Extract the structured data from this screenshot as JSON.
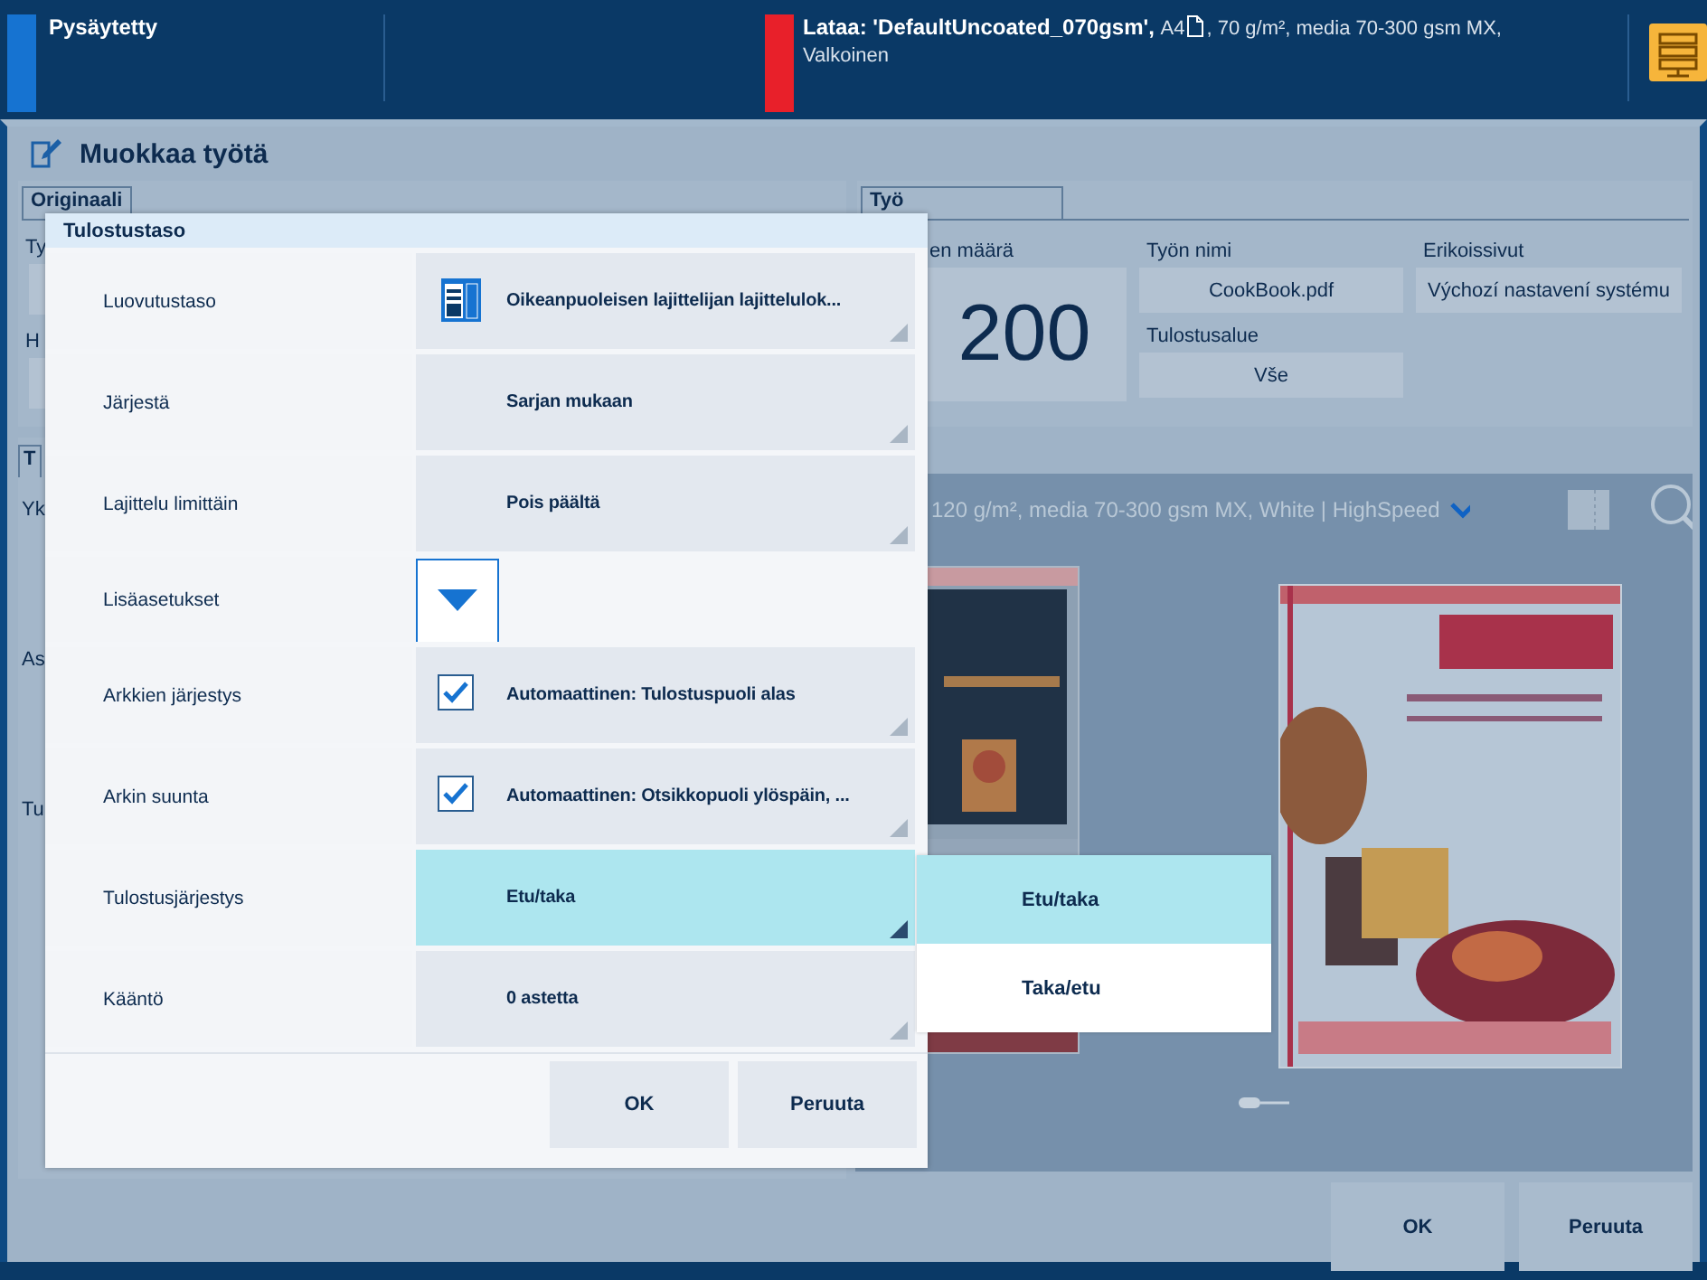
{
  "status_bar": {
    "state": "Pysäytetty",
    "load_label": "Lataa: 'DefaultUncoated_070gsm',",
    "load_size": "A4",
    "load_media": ", 70 g/m², media 70-300 gsm MX,",
    "load_color": "Valkoinen"
  },
  "window": {
    "title": "Muokkaa työtä"
  },
  "original_group": {
    "tab": "Originaali",
    "labels": [
      "Ty",
      "H"
    ]
  },
  "job_group": {
    "tab": "Työ",
    "count_label": "en määrä",
    "count": "200",
    "fields": [
      {
        "label": "Työn nimi",
        "value": "CookBook.pdf"
      },
      {
        "label": "Erikoissivut",
        "value": "Výchozí nastavení systému"
      },
      {
        "label": "Tulostusalue",
        "value": "Vše"
      }
    ]
  },
  "output_section": {
    "tab": "T",
    "labels": [
      "Yk",
      "As",
      "Tu"
    ],
    "media_summary": "120 g/m², media 70-300 gsm MX, White | HighSpeed"
  },
  "dialog": {
    "title": "Tulostustaso",
    "rows": [
      {
        "label": "Luovutustaso",
        "kind": "tray-select",
        "value": "Oikeanpuoleisen lajittelijan lajittelulok...",
        "expanded": false
      },
      {
        "label": "Järjestä",
        "kind": "select",
        "value": "Sarjan mukaan",
        "expanded": false
      },
      {
        "label": "Lajittelu limittäin",
        "kind": "select",
        "value": "Pois päältä",
        "expanded": false
      },
      {
        "label": "Lisäasetukset",
        "kind": "expander",
        "expanded": false
      },
      {
        "label": "Arkkien järjestys",
        "kind": "check-select",
        "checked": true,
        "value": "Automaattinen: Tulostuspuoli alas",
        "expanded": false
      },
      {
        "label": "Arkin suunta",
        "kind": "check-select",
        "checked": true,
        "value": "Automaattinen: Otsikkopuoli ylöspäin, ...",
        "expanded": false
      },
      {
        "label": "Tulostusjärjestys",
        "kind": "select",
        "value": "Etu/taka",
        "expanded": true,
        "options": [
          {
            "label": "Etu/taka",
            "selected": true
          },
          {
            "label": "Taka/etu",
            "selected": false
          }
        ]
      },
      {
        "label": "Kääntö",
        "kind": "select",
        "value": "0 astetta",
        "expanded": false
      }
    ],
    "buttons": [
      "OK",
      "Peruuta"
    ]
  },
  "footer_buttons": [
    "OK",
    "Peruuta"
  ]
}
